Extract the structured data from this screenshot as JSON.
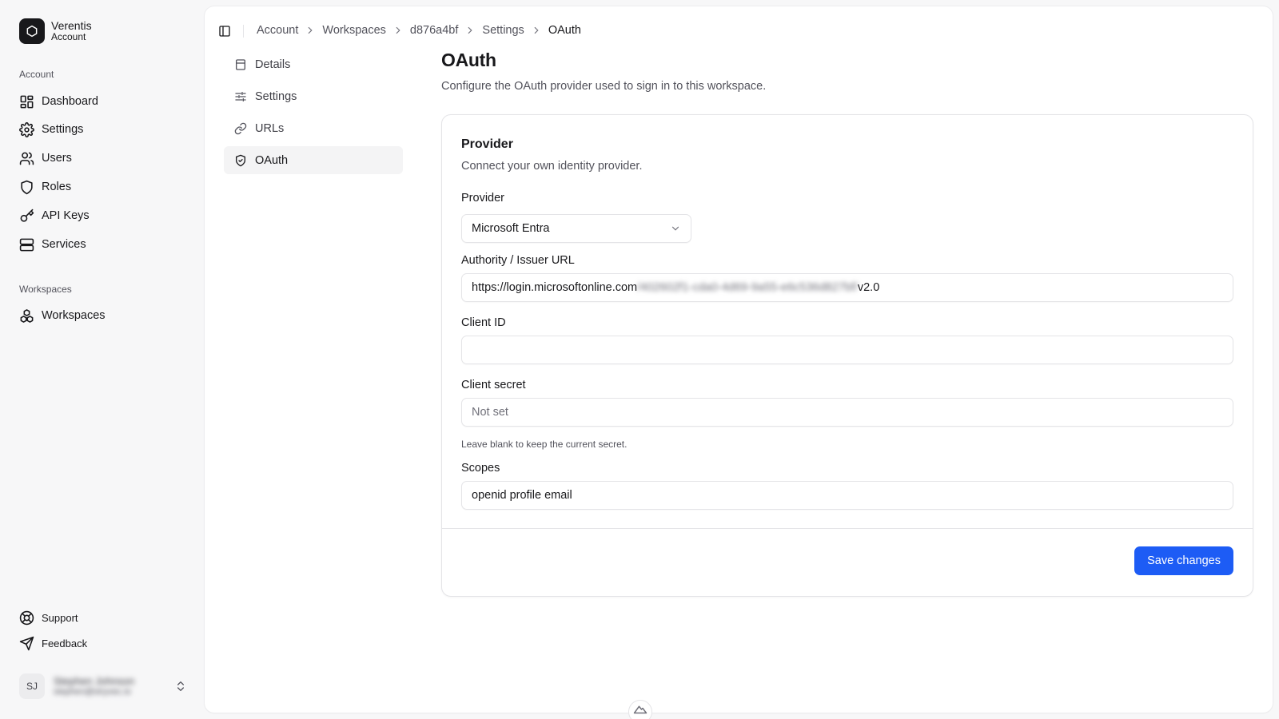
{
  "brand": {
    "name": "Verentis",
    "subtitle": "Account"
  },
  "sidebar": {
    "account_section": "Account",
    "account_items": [
      {
        "label": "Dashboard",
        "icon": "layout-grid-icon"
      },
      {
        "label": "Settings",
        "icon": "gear-icon"
      },
      {
        "label": "Users",
        "icon": "users-icon"
      },
      {
        "label": "Roles",
        "icon": "shield-icon"
      },
      {
        "label": "API Keys",
        "icon": "key-icon"
      },
      {
        "label": "Services",
        "icon": "server-icon"
      }
    ],
    "workspaces_section": "Workspaces",
    "workspace_items": [
      {
        "label": "Workspaces",
        "icon": "workspaces-icon"
      }
    ],
    "footer_items": [
      {
        "label": "Support",
        "icon": "life-buoy-icon"
      },
      {
        "label": "Feedback",
        "icon": "send-icon"
      }
    ],
    "user": {
      "initials": "SJ",
      "name": "Stephen Johnson",
      "email": "stephen@stryvec.io"
    }
  },
  "breadcrumb": [
    "Account",
    "Workspaces",
    "d876a4bf",
    "Settings",
    "OAuth"
  ],
  "subnav": [
    {
      "label": "Details",
      "icon": "file-icon",
      "active": false
    },
    {
      "label": "Settings",
      "icon": "sliders-icon",
      "active": false
    },
    {
      "label": "URLs",
      "icon": "link-icon",
      "active": false
    },
    {
      "label": "OAuth",
      "icon": "shield-check-icon",
      "active": true
    }
  ],
  "page": {
    "title": "OAuth",
    "description": "Configure the OAuth provider used to sign in to this workspace."
  },
  "card": {
    "title": "Provider",
    "description": "Connect your own identity provider.",
    "provider": {
      "label": "Provider",
      "value": "Microsoft Entra"
    },
    "authority": {
      "label": "Authority / Issuer URL",
      "value_prefix": "https://login.microsoftonline.com",
      "value_blurred": "/402602f1-cda0-4d69-9a55-e6c536d827bf/",
      "value_suffix": "v2.0"
    },
    "client_id": {
      "label": "Client ID",
      "value": ""
    },
    "client_secret": {
      "label": "Client secret",
      "placeholder": "Not set",
      "hint": "Leave blank to keep the current secret."
    },
    "scopes": {
      "label": "Scopes",
      "value": "openid profile email"
    },
    "save_label": "Save changes"
  },
  "colors": {
    "accent": "#1d5cf5",
    "text": "#18181b",
    "muted": "#52525b",
    "border": "#e4e4e7"
  }
}
